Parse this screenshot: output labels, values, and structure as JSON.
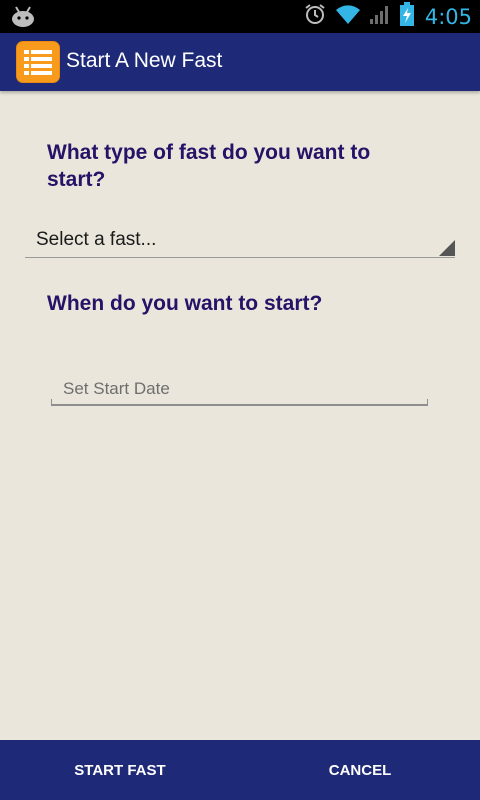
{
  "status_bar": {
    "time": "4:05",
    "icons": [
      "android-debug-icon",
      "alarm-icon",
      "wifi-icon",
      "signal-icon",
      "battery-charging-icon"
    ],
    "time_color": "#33B5E5"
  },
  "action_bar": {
    "title": "Start A New Fast",
    "icon": "list-icon",
    "background": "#1E2A78",
    "icon_color": "#F89A1C"
  },
  "form": {
    "fast_type_question": "What type of fast do you want to start?",
    "fast_type_value": "Select a fast...",
    "start_question": "When do you want to start?",
    "start_date_placeholder": "Set Start Date"
  },
  "buttons": {
    "start_label": "START FAST",
    "cancel_label": "CANCEL"
  },
  "colors": {
    "background": "#EAE6DB",
    "question_text": "#261266"
  }
}
